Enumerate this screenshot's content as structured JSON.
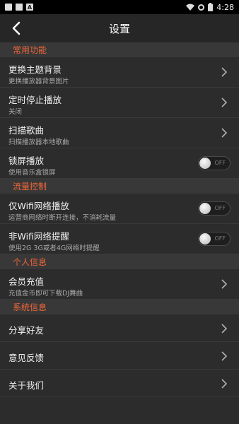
{
  "status_bar": {
    "time": "4:28",
    "icons": [
      "image-icon",
      "square-icon",
      "a-icon",
      "wifi-icon",
      "settings-icon",
      "battery-icon"
    ]
  },
  "header": {
    "title": "设置",
    "back_icon": "back-chevron-icon"
  },
  "colors": {
    "accent": "#f0663a",
    "background": "#2c2c2c",
    "section_bg": "#383838"
  },
  "sections": {
    "common": {
      "title": "常用功能",
      "items": [
        {
          "label": "更换主题背景",
          "sub": "更换播放器背景图片"
        },
        {
          "label": "定时停止播放",
          "sub": "关闭"
        },
        {
          "label": "扫描歌曲",
          "sub": "扫描播放器本地歌曲"
        },
        {
          "label": "锁屏播放",
          "sub": "使用音乐盒锁屏",
          "toggle": "OFF"
        }
      ]
    },
    "traffic": {
      "title": "流量控制",
      "items": [
        {
          "label": "仅Wifi网络播放",
          "sub": "运营商网络时断开连接，不消耗流量",
          "toggle": "OFF"
        },
        {
          "label": "非Wifi网络提醒",
          "sub": "使用2G  3G或者4G网络时提醒",
          "toggle": "OFF"
        }
      ]
    },
    "personal": {
      "title": "个人信息",
      "items": [
        {
          "label": "会员充值",
          "sub": "充值金币即可下载DJ舞曲"
        }
      ]
    },
    "system": {
      "title": "系统信息",
      "items": [
        {
          "label": "分享好友"
        },
        {
          "label": "意见反馈"
        },
        {
          "label": "关于我们"
        }
      ]
    }
  }
}
